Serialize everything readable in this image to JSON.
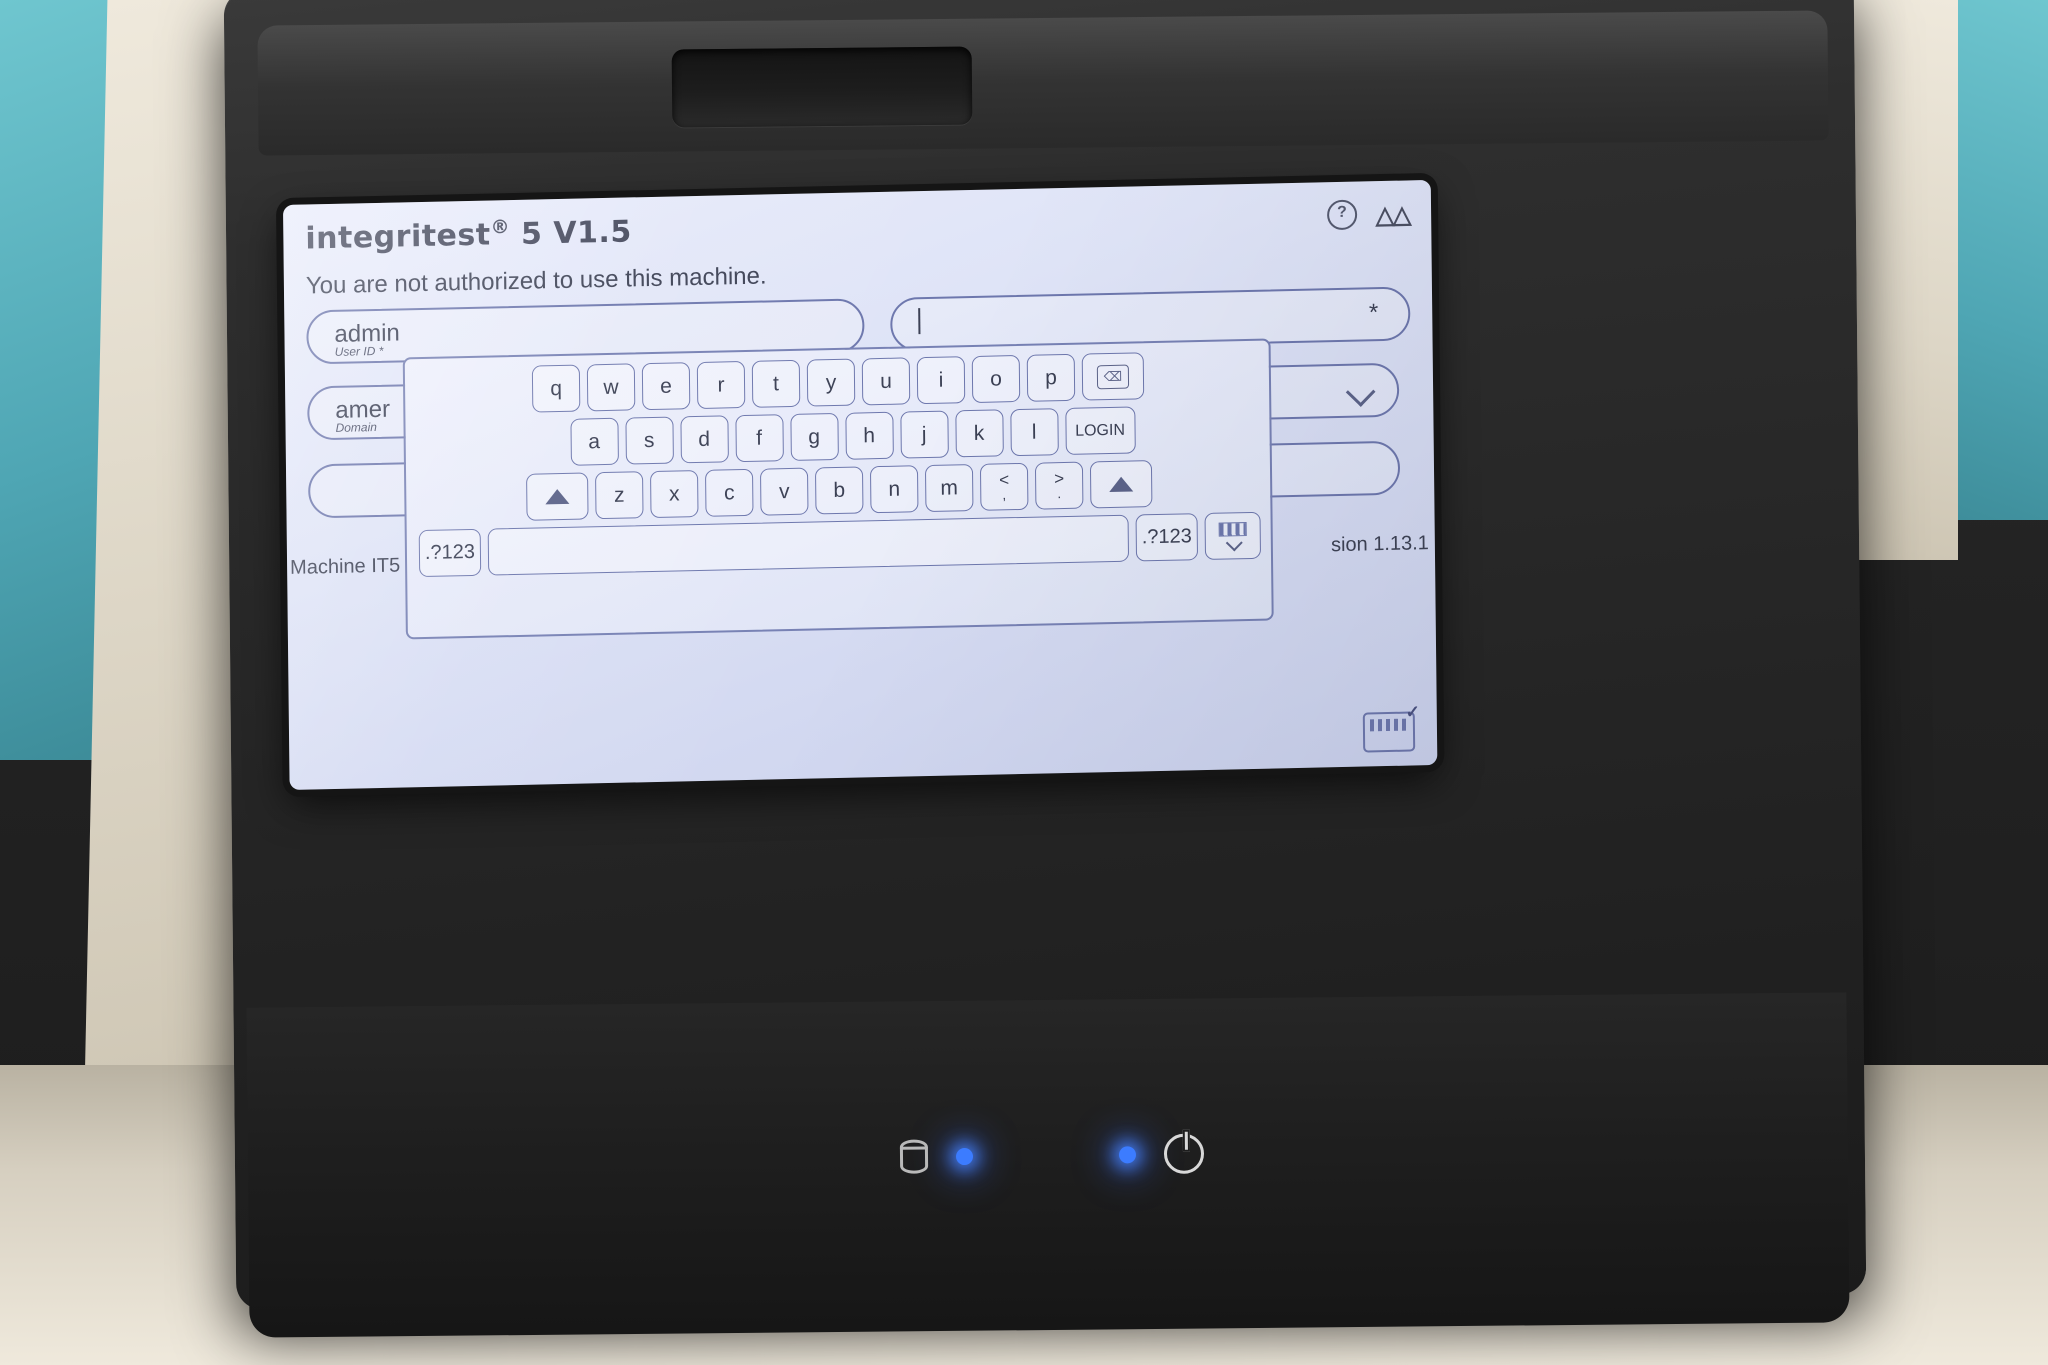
{
  "device": {
    "name": "integritest-5-instrument",
    "leds": [
      "drive-activity-led",
      "power-led"
    ]
  },
  "screen": {
    "header": {
      "product_title": "integritest",
      "product_reg": "®",
      "product_version": " 5 V1.5",
      "help_icon_label": "?",
      "brand_logo_text": "M"
    },
    "notice": "You are not authorized to use this machine.",
    "fields": {
      "user_id": {
        "value": "admin",
        "caption": "User ID *"
      },
      "password": {
        "value": "",
        "caption": "",
        "star": "*"
      },
      "domain": {
        "value": "amer",
        "caption": "Domain"
      },
      "third": {
        "value": "",
        "caption": ""
      }
    },
    "footer": {
      "machine": "Machine IT5",
      "version": "sion 1.13.1"
    },
    "keyboard_done_label": ""
  },
  "keyboard": {
    "row1": [
      "q",
      "w",
      "e",
      "r",
      "t",
      "y",
      "u",
      "i",
      "o",
      "p"
    ],
    "backspace_label": "⌫",
    "row2": [
      "a",
      "s",
      "d",
      "f",
      "g",
      "h",
      "j",
      "k",
      "l"
    ],
    "login_label": "LOGIN",
    "shift_left_label": "shift",
    "row3": [
      "z",
      "x",
      "c",
      "v",
      "b",
      "n",
      "m"
    ],
    "punct": [
      {
        "up": "<",
        "lo": ","
      },
      {
        "up": ">",
        "lo": "."
      }
    ],
    "shift_right_label": "shift",
    "num_left_label": ".?123",
    "space_label": "",
    "num_right_label": ".?123",
    "hide_keyboard_label": ""
  },
  "colors": {
    "screen_bg": "#dfe4f7",
    "key_border": "#6d77ad",
    "text": "#3b4054",
    "bezel": "#252525",
    "teal_panel": "#4fa6b4",
    "led_blue": "#3c7cff"
  }
}
